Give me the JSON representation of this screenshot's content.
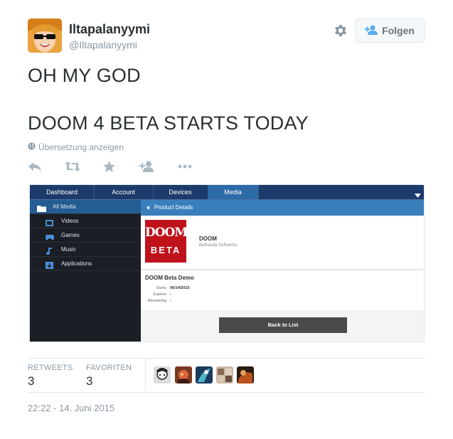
{
  "user": {
    "name": "Iltapalanyymi",
    "handle": "@Iltapalanyymi"
  },
  "follow_label": "Folgen",
  "tweet": {
    "line1": "OH MY GOD",
    "line2": "DOOM 4 BETA STARTS TODAY"
  },
  "translate_label": "Übersetzung anzeigen",
  "media": {
    "nav": [
      "Dashboard",
      "Account",
      "Devices",
      "Media"
    ],
    "active_nav": "Media",
    "sidebar": [
      "All Media",
      "Videos",
      "Games",
      "Music",
      "Applications"
    ],
    "breadcrumb": "Product Details",
    "logo_top": "DOOM",
    "logo_bottom": "BETA",
    "game_title": "DOOM",
    "publisher": "Bethesda Softworks",
    "demo_title": "DOOM Beta Demo",
    "details": {
      "labels": [
        "Starts",
        "Expires",
        "Remaining"
      ],
      "values": [
        "06/14/2015",
        "-",
        "-"
      ]
    },
    "back_button": "Back to List"
  },
  "stats": {
    "retweets_label": "RETWEETS",
    "retweets": "3",
    "favorites_label": "FAVORITEN",
    "favorites": "3"
  },
  "timestamp": "22:22 - 14. Juni 2015",
  "colors": {
    "twitter_blue": "#55acee",
    "nav_bg": "#1c3b6b",
    "sidebar_bg": "#1b1e24",
    "doom_red": "#c0121b"
  }
}
